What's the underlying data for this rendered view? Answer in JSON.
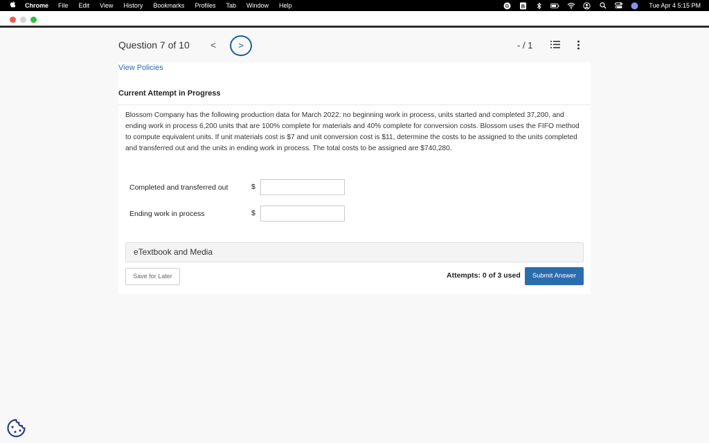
{
  "menubar": {
    "app": "Chrome",
    "items": [
      "File",
      "Edit",
      "View",
      "History",
      "Bookmarks",
      "Profiles",
      "Tab",
      "Window",
      "Help"
    ],
    "clock": "Tue Apr 4  5:15 PM"
  },
  "header": {
    "question_label": "Question 7 of 10",
    "prev_symbol": "<",
    "next_symbol": ">",
    "score": "- / 1"
  },
  "links": {
    "view_policies": "View Policies"
  },
  "attempt": {
    "title": "Current Attempt in Progress"
  },
  "question": {
    "text": "Blossom Company has the following production data for March 2022: no beginning work in process, units started and completed 37,200, and ending work in process 6,200 units that are 100% complete for materials and 40% complete for conversion costs. Blossom uses the FIFO method to compute equivalent units. If unit materials cost is $7 and unit conversion cost is $11, determine the costs to be assigned to the units completed and transferred out and the units in ending work in process. The total costs to be assigned are $740,280."
  },
  "answers": [
    {
      "label": "Completed and transferred out",
      "currency": "$",
      "value": ""
    },
    {
      "label": "Ending work in process",
      "currency": "$",
      "value": ""
    }
  ],
  "etextbook": {
    "label": "eTextbook and Media"
  },
  "footer": {
    "save_label": "Save for Later",
    "attempts_label": "Attempts: 0 of 3 used",
    "submit_label": "Submit Answer"
  },
  "colors": {
    "accent": "#2b6cad",
    "link": "#2a6bb0",
    "next_circle": "#1f5d97"
  }
}
